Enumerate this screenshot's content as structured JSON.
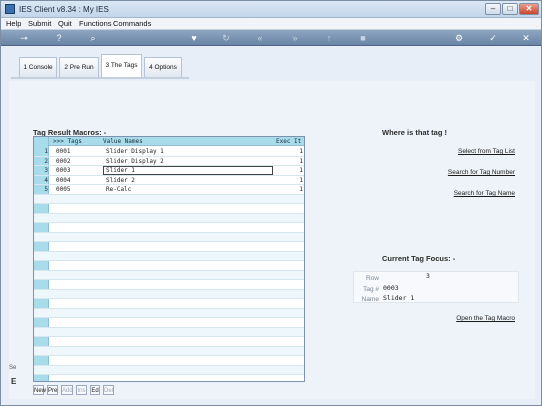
{
  "window": {
    "title": "IES Client v8.34 : My IES"
  },
  "menubar": {
    "items": [
      "Help",
      "Submit",
      "Quit",
      "Functions",
      "Commands"
    ]
  },
  "toolbar": {
    "icons": [
      "key-icon",
      "help-icon",
      "search-icon",
      "heart-icon",
      "refresh-icon",
      "rewind-icon",
      "fast-forward-icon",
      "upload-icon",
      "stop-icon",
      "settings-icon",
      "check-icon",
      "close-icon"
    ]
  },
  "tabs": [
    {
      "label": "1 Console",
      "active": false
    },
    {
      "label": "2 Pre Run",
      "active": false
    },
    {
      "label": "3 The Tags",
      "active": true
    },
    {
      "label": "4 Options",
      "active": false
    }
  ],
  "macros": {
    "title": "Tag Result Macros: -",
    "columns": [
      ">>> Tags",
      "Value Names",
      "Exec It"
    ],
    "rows": [
      {
        "n": "1",
        "tag": "0001",
        "name": "Slider Display 1",
        "exec": "1"
      },
      {
        "n": "2",
        "tag": "0002",
        "name": "Slider Display 2",
        "exec": "1"
      },
      {
        "n": "3",
        "tag": "0003",
        "name": "Slider 1",
        "exec": "1"
      },
      {
        "n": "4",
        "tag": "0004",
        "name": "Slider 2",
        "exec": "1"
      },
      {
        "n": "5",
        "tag": "0005",
        "name": "Re-Calc",
        "exec": "1"
      }
    ],
    "selected_row": 3,
    "footer_buttons": [
      {
        "label": "New",
        "enabled": true
      },
      {
        "label": "Pre",
        "enabled": true
      },
      {
        "label": "Add",
        "enabled": false
      },
      {
        "label": "Ins",
        "enabled": false
      },
      {
        "label": "Ed",
        "enabled": true
      },
      {
        "label": "Del",
        "enabled": false
      }
    ]
  },
  "where": {
    "title": "Where is that tag !",
    "links": [
      "Select from Tag List",
      "Search for Tag Number",
      "Search for Tag Name"
    ]
  },
  "focus": {
    "title": "Current Tag Focus: -",
    "row_label": "Row",
    "row_value": "3",
    "tag_label": "Tag #",
    "tag_value": "0003",
    "name_label": "Name",
    "name_value": "Slider 1",
    "open_link": "Open the Tag Macro"
  },
  "side": {
    "stub1": "Se",
    "stub2": "E"
  }
}
